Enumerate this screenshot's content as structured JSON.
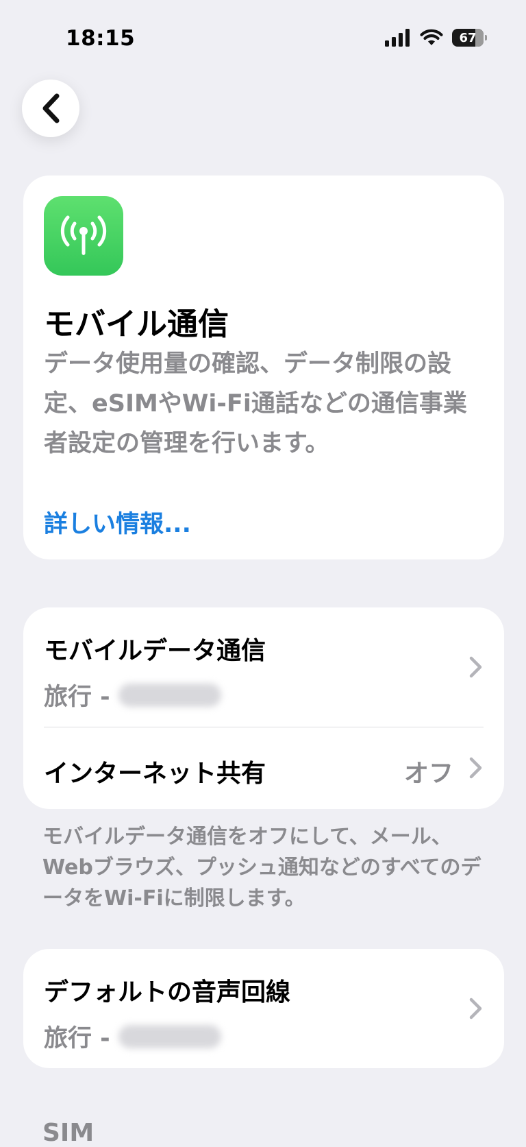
{
  "status_bar": {
    "time": "18:15",
    "battery_level": "67",
    "icons": [
      "cellular-signal-icon",
      "wifi-icon",
      "battery-icon"
    ]
  },
  "nav": {
    "back_icon": "chevron-left-icon"
  },
  "intro": {
    "icon": "antenna-icon",
    "icon_color": "#34c759",
    "title": "モバイル通信",
    "description": "データ使用量の確認、データ制限の設定、eSIMやWi-Fi通話などの通信事業者設定の管理を行います。",
    "link": "詳しい情報..."
  },
  "mobile_section": {
    "rows": [
      {
        "title": "モバイルデータ通信",
        "subtitle": "旅行 -",
        "value": ""
      },
      {
        "title": "インターネット共有",
        "subtitle": "",
        "value": "オフ"
      }
    ],
    "footer": "モバイルデータ通信をオフにして、メール、Webブラウズ、プッシュ通知などのすべてのデータをWi-Fiに制限します。"
  },
  "voice_section": {
    "title": "デフォルトの音声回線",
    "subtitle": "旅行 -"
  },
  "sim_section": {
    "header": "SIM"
  },
  "colors": {
    "background": "#efeff4",
    "link": "#1a7fe0",
    "secondary_text": "#8a8a8e"
  }
}
